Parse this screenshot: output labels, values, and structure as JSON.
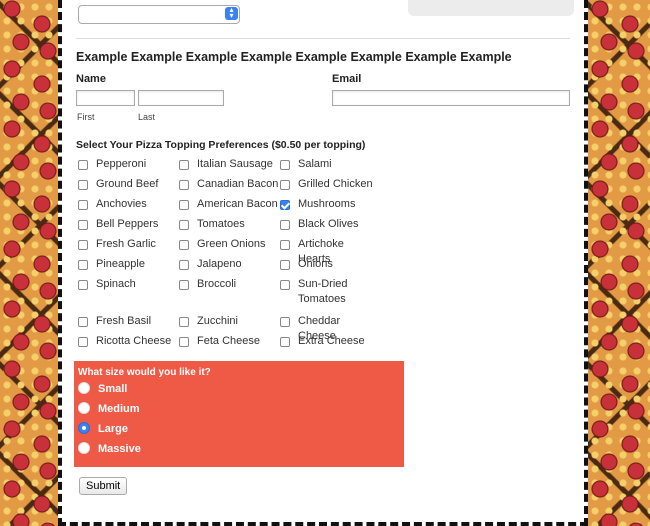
{
  "form": {
    "heading": "Example Example Example Example Example Example Example Example",
    "name_label": "Name",
    "first_sublabel": "First",
    "last_sublabel": "Last",
    "email_label": "Email",
    "toppings_title": "Select Your Pizza Topping Preferences ($0.50 per topping)",
    "toppings": [
      {
        "label": "Pepperoni",
        "checked": false
      },
      {
        "label": "Italian Sausage",
        "checked": false
      },
      {
        "label": "Salami",
        "checked": false
      },
      {
        "label": "Ground Beef",
        "checked": false
      },
      {
        "label": "Canadian Bacon",
        "checked": false
      },
      {
        "label": "Grilled Chicken",
        "checked": false
      },
      {
        "label": "Anchovies",
        "checked": false
      },
      {
        "label": "American Bacon",
        "checked": false
      },
      {
        "label": "Mushrooms",
        "checked": true
      },
      {
        "label": "Bell Peppers",
        "checked": false
      },
      {
        "label": "Tomatoes",
        "checked": false
      },
      {
        "label": "Black Olives",
        "checked": false
      },
      {
        "label": "Fresh Garlic",
        "checked": false
      },
      {
        "label": "Green Onions",
        "checked": false
      },
      {
        "label": "Artichoke Hearts",
        "checked": false
      },
      {
        "label": "Pineapple",
        "checked": false
      },
      {
        "label": "Jalapeno",
        "checked": false
      },
      {
        "label": "Onions",
        "checked": false
      },
      {
        "label": "Spinach",
        "checked": false
      },
      {
        "label": "Broccoli",
        "checked": false
      },
      {
        "label": "Sun-Dried Tomatoes",
        "checked": false
      },
      {
        "label": "Fresh Basil",
        "checked": false
      },
      {
        "label": "Zucchini",
        "checked": false
      },
      {
        "label": "Cheddar Cheese",
        "checked": false
      },
      {
        "label": "Ricotta Cheese",
        "checked": false
      },
      {
        "label": "Feta Cheese",
        "checked": false
      },
      {
        "label": "Extra Cheese",
        "checked": false
      }
    ],
    "size_title": "What size would you like it?",
    "sizes": [
      {
        "label": "Small",
        "selected": false
      },
      {
        "label": "Medium",
        "selected": false
      },
      {
        "label": "Large",
        "selected": true
      },
      {
        "label": "Massive",
        "selected": false
      }
    ],
    "submit_label": "Submit"
  },
  "colors": {
    "size_box_bg": "#ef5a46",
    "accent_blue": "#3b82f0"
  }
}
